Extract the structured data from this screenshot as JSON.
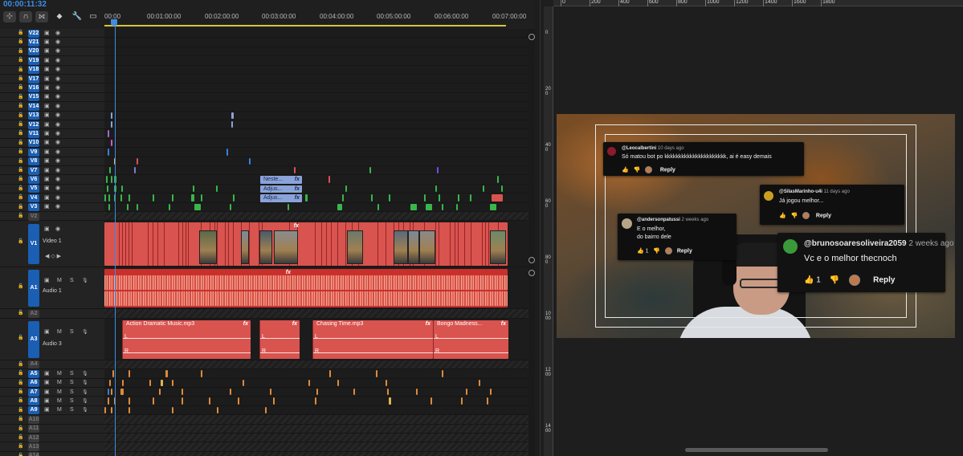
{
  "timeline": {
    "timecode": "00:00:11:32",
    "tools": [
      {
        "icon": "insert-snap-icon",
        "glyph": "⊹"
      },
      {
        "icon": "magnet-icon",
        "glyph": "∩"
      },
      {
        "icon": "linked-selection-icon",
        "glyph": "⟗"
      },
      {
        "icon": "marker-icon",
        "glyph": "⬥"
      },
      {
        "icon": "wrench-icon",
        "glyph": "🔧"
      },
      {
        "icon": "captions-icon",
        "glyph": "▭"
      }
    ],
    "ruler_ticks": [
      "00:00",
      "00:01:00:00",
      "00:02:00:00",
      "00:03:00:00",
      "00:04:00:00",
      "00:05:00:00",
      "00:06:00:00",
      "00:07:00:00"
    ],
    "video_tracks": [
      "V22",
      "V21",
      "V20",
      "V19",
      "V18",
      "V17",
      "V16",
      "V15",
      "V14",
      "V13",
      "V12",
      "V11",
      "V10",
      "V9",
      "V8",
      "V7",
      "V6",
      "V5",
      "V4",
      "V3",
      "V2"
    ],
    "v1": {
      "name": "V1",
      "label": "Video 1"
    },
    "a1": {
      "name": "A1",
      "label": "Audio 1"
    },
    "a2": {
      "name": "A2"
    },
    "a3": {
      "name": "A3",
      "label": "Audio 3"
    },
    "audio_tracks_small": [
      "A4",
      "A5",
      "A6",
      "A7",
      "A8",
      "A9",
      "A10",
      "A11",
      "A12",
      "A13",
      "A14"
    ],
    "toggle_m": "M",
    "toggle_s": "S",
    "fx": "fx",
    "adjust_clips": [
      "Neste...",
      "Adjus...",
      "Adjus..."
    ],
    "audio_clips": [
      "Action Dramatic Music.mp3",
      "Chasing Time.mp3",
      "Bongo Madness..."
    ],
    "channel_l": "L",
    "channel_r": "R",
    "colors": {
      "track_active": "#1a5fb4",
      "clip_red": "#d9534f",
      "playhead": "#3d8de6",
      "adjustment": "#8aa3d9"
    }
  },
  "monitor": {
    "hruler_labels": [
      "0",
      "200",
      "400",
      "600",
      "800",
      "1000",
      "1200",
      "1400",
      "1600",
      "1800"
    ],
    "vruler_labels": [
      "0",
      "200",
      "400",
      "600",
      "800",
      "1000",
      "1200",
      "1400"
    ],
    "comments": [
      {
        "user": "@Leocalbertini",
        "age": "10 days ago",
        "text": "Só matou bot po kkkkkkkkkkkkkkkkkkkkkk, ai é easy demais",
        "likes": "",
        "reply": "Reply"
      },
      {
        "user": "@SilasMarinho-u4i",
        "age": "11 days ago",
        "text": "Já jogou melhor...",
        "likes": "",
        "reply": "Reply"
      },
      {
        "user": "@andersonpatussi",
        "age": "2 weeks ago",
        "text": "E o melhor,",
        "text2": "do bairro dele",
        "likes": "1",
        "reply": "Reply"
      },
      {
        "user": "@brunosoaresoliveira2059",
        "age": "2 weeks ago",
        "text": "Vc e o melhor thecnoch",
        "likes": "1",
        "reply": "Reply"
      }
    ]
  }
}
